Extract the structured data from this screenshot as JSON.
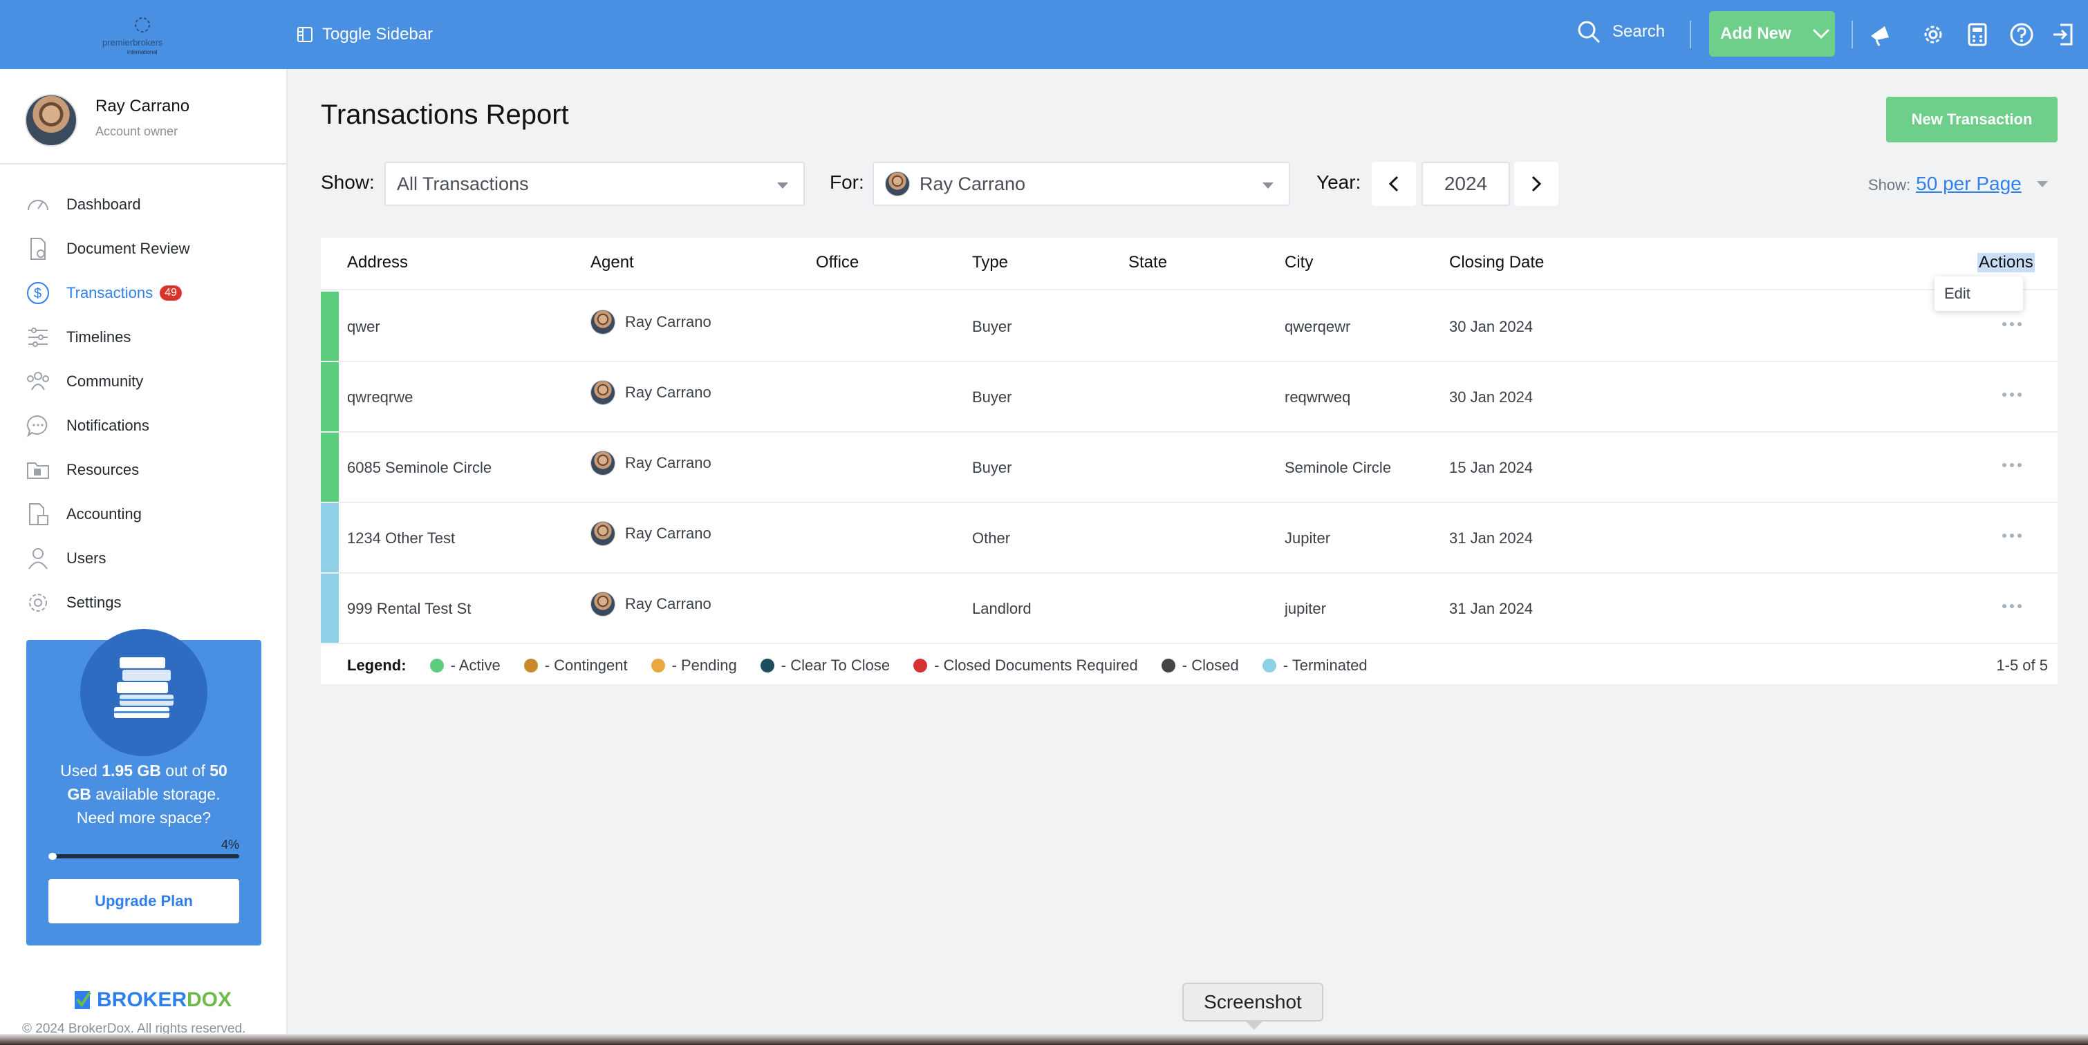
{
  "topbar": {
    "logo_text_1": "premierbrokers",
    "logo_text_2": "international",
    "toggle_label": "Toggle Sidebar",
    "search_label": "Search",
    "add_new_label": "Add New"
  },
  "profile": {
    "name": "Ray Carrano",
    "role": "Account owner"
  },
  "sidebar": {
    "items": [
      {
        "label": "Dashboard",
        "icon": "dashboard-icon"
      },
      {
        "label": "Document Review",
        "icon": "document-review-icon"
      },
      {
        "label": "Transactions",
        "icon": "dollar-icon",
        "badge": "49",
        "active": true
      },
      {
        "label": "Timelines",
        "icon": "timelines-icon"
      },
      {
        "label": "Community",
        "icon": "community-icon"
      },
      {
        "label": "Notifications",
        "icon": "chat-icon"
      },
      {
        "label": "Resources",
        "icon": "folder-icon"
      },
      {
        "label": "Accounting",
        "icon": "accounting-icon"
      },
      {
        "label": "Users",
        "icon": "user-icon"
      },
      {
        "label": "Settings",
        "icon": "gear-icon"
      }
    ]
  },
  "storage": {
    "used_prefix": "Used ",
    "used": "1.95 GB",
    "out_of": " out of ",
    "total_1": "50",
    "total_2": "GB",
    "suffix": " available storage.",
    "need_more": "Need more space?",
    "percent_label": "4%",
    "percent": 4,
    "upgrade_label": "Upgrade Plan"
  },
  "footer": {
    "brand_1": "BROKER",
    "brand_2": "DOX",
    "copyright": "© 2024 BrokerDox. All rights reserved."
  },
  "main": {
    "title": "Transactions Report",
    "new_transaction_label": "New Transaction",
    "filters": {
      "show_label": "Show:",
      "show_value": "All Transactions",
      "for_label": "For:",
      "for_value": "Ray Carrano",
      "year_label": "Year:",
      "year_value": "2024",
      "per_page_label": "Show:",
      "per_page_value": "50 per Page"
    },
    "columns": [
      "Address",
      "Agent",
      "Office",
      "Type",
      "State",
      "City",
      "Closing Date",
      "Actions"
    ],
    "rows": [
      {
        "address": "qwer",
        "agent": "Ray Carrano",
        "office": "",
        "type": "Buyer",
        "state": "",
        "city": "qwerqewr",
        "closing_date": "30 Jan 2024",
        "status_color": "#5ccd7c"
      },
      {
        "address": "qwreqrwe",
        "agent": "Ray Carrano",
        "office": "",
        "type": "Buyer",
        "state": "",
        "city": "reqwrweq",
        "closing_date": "30 Jan 2024",
        "status_color": "#5ccd7c"
      },
      {
        "address": "6085 Seminole Circle",
        "agent": "Ray Carrano",
        "office": "",
        "type": "Buyer",
        "state": "",
        "city": "Seminole Circle",
        "closing_date": "15 Jan 2024",
        "status_color": "#5ccd7c"
      },
      {
        "address": "1234 Other Test",
        "agent": "Ray Carrano",
        "office": "",
        "type": "Other",
        "state": "",
        "city": "Jupiter",
        "closing_date": "31 Jan 2024",
        "status_color": "#8fd0e6"
      },
      {
        "address": "999 Rental Test St",
        "agent": "Ray Carrano",
        "office": "",
        "type": "Landlord",
        "state": "",
        "city": "jupiter",
        "closing_date": "31 Jan 2024",
        "status_color": "#8fd0e6"
      }
    ],
    "edit_popup_label": "Edit",
    "legend_title": "Legend:",
    "legend": [
      {
        "label": "- Active",
        "color": "#5ccd7c"
      },
      {
        "label": "- Contingent",
        "color": "#c98a2e"
      },
      {
        "label": "- Pending",
        "color": "#e9a840"
      },
      {
        "label": "- Clear To Close",
        "color": "#1d4e5e"
      },
      {
        "label": "- Closed Documents Required",
        "color": "#d63333"
      },
      {
        "label": "- Closed",
        "color": "#444444"
      },
      {
        "label": "- Terminated",
        "color": "#8fd0e6"
      }
    ],
    "count_text": "1-5 of 5"
  },
  "tooltip": {
    "label": "Screenshot"
  }
}
